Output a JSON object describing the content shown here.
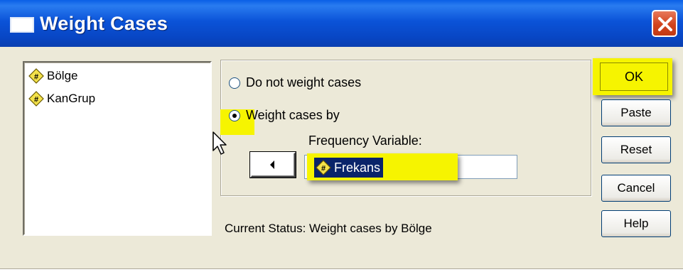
{
  "window": {
    "title": "Weight Cases"
  },
  "variables": [
    {
      "name": "Bölge",
      "icon": "numeric-variable-icon"
    },
    {
      "name": "KanGrup",
      "icon": "numeric-variable-icon"
    }
  ],
  "options": {
    "no_weight_label": "Do not weight cases",
    "weight_by_label": "Weight cases by",
    "selected": "Weight cases by"
  },
  "frequency": {
    "label": "Frequency Variable:",
    "value": "Frekans"
  },
  "status": "Current Status: Weight cases by Bölge",
  "buttons": {
    "ok": "OK",
    "paste": "Paste",
    "reset": "Reset",
    "cancel": "Cancel",
    "help": "Help"
  },
  "colors": {
    "highlight": "#f6f400",
    "titlebar": "#0a53d8",
    "selection": "#0a246a"
  }
}
